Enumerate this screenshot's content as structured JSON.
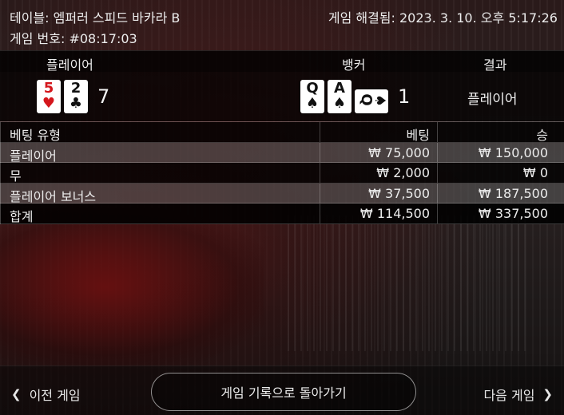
{
  "header": {
    "table_label": "테이블: 엠퍼러 스피드 바카라 B",
    "resolved_label": "게임 해결됨: 2023. 3. 10. 오후 5:17:26",
    "game_number_label": "게임 번호: #08:17:03"
  },
  "results": {
    "player_header": "플레이어",
    "banker_header": "뱅커",
    "result_header": "결과",
    "player_score": "7",
    "banker_score": "1",
    "result_value": "플레이어",
    "player_cards": [
      {
        "rank": "5",
        "suit": "♥",
        "color": "#d4161c"
      },
      {
        "rank": "2",
        "suit": "♣",
        "color": "#111111"
      }
    ],
    "banker_cards": [
      {
        "rank": "Q",
        "suit": "♠",
        "color": "#111111"
      },
      {
        "rank": "A",
        "suit": "♠",
        "color": "#111111"
      },
      {
        "rank": "Q",
        "suit": "♠",
        "color": "#111111",
        "orientation": "sideways"
      }
    ]
  },
  "bets": {
    "col_type": "베팅 유형",
    "col_bet": "베팅",
    "col_win": "승",
    "rows": [
      {
        "type": "플레이어",
        "bet": "₩ 75,000",
        "win": "₩ 150,000"
      },
      {
        "type": "무",
        "bet": "₩ 2,000",
        "win": "₩ 0"
      },
      {
        "type": "플레이어 보너스",
        "bet": "₩ 37,500",
        "win": "₩ 187,500"
      }
    ],
    "total": {
      "type": "합계",
      "bet": "₩ 114,500",
      "win": "₩ 337,500"
    }
  },
  "nav": {
    "prev_label": "이전 게임",
    "back_label": "게임 기록으로 돌아가기",
    "next_label": "다음 게임"
  }
}
